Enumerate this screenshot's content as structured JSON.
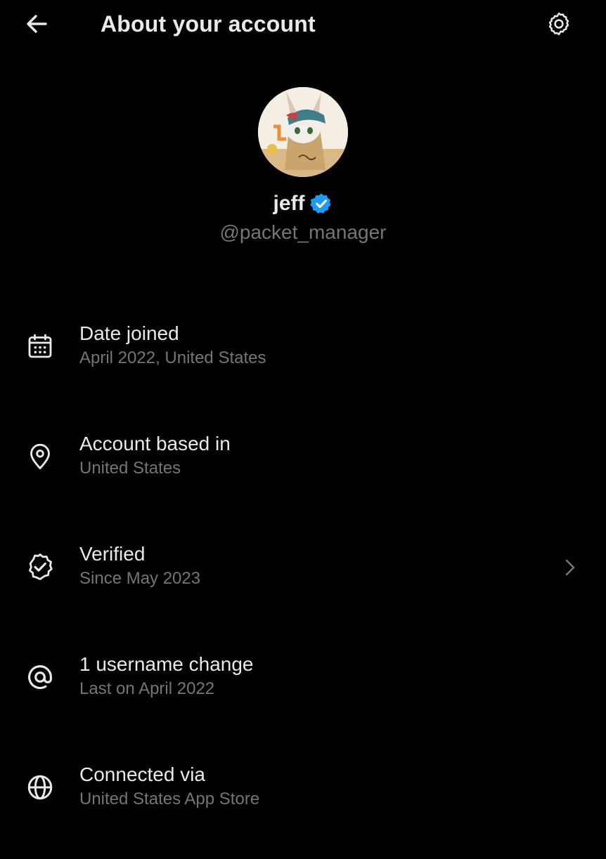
{
  "header": {
    "title": "About your account",
    "back_icon": "arrow-left-icon",
    "settings_icon": "gear-icon"
  },
  "profile": {
    "display_name": "jeff",
    "handle": "@packet_manager",
    "verified_color": "#1d9bf0"
  },
  "info_items": [
    {
      "icon": "calendar-icon",
      "title": "Date joined",
      "subtitle": "April 2022, United States"
    },
    {
      "icon": "location-pin-icon",
      "title": "Account based in",
      "subtitle": "United States"
    },
    {
      "icon": "verified-badge-icon",
      "title": "Verified",
      "subtitle": "Since May 2023",
      "has_chevron": true
    },
    {
      "icon": "at-sign-icon",
      "title": "1 username change",
      "subtitle": "Last on April 2022"
    },
    {
      "icon": "globe-icon",
      "title": "Connected via",
      "subtitle": "United States App Store"
    }
  ],
  "colors": {
    "background": "#000000",
    "primary_text": "#e7e9ea",
    "secondary_text": "#71767b",
    "accent": "#1d9bf0"
  }
}
